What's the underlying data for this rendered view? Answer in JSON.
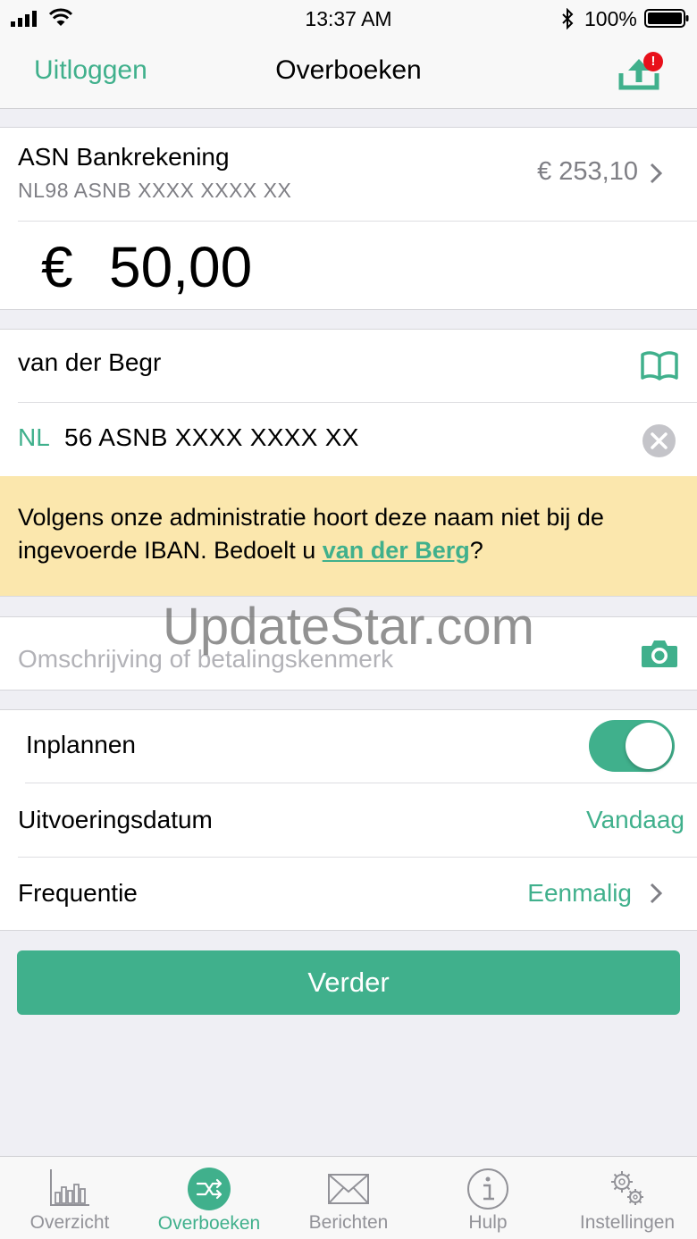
{
  "status_bar": {
    "time": "13:37 AM",
    "battery": "100%"
  },
  "nav": {
    "left": "Uitloggen",
    "title": "Overboeken",
    "badge": "!"
  },
  "account": {
    "name": "ASN Bankrekening",
    "iban": "NL98 ASNB XXXX XXXX XX",
    "balance": "€ 253,10"
  },
  "amount": {
    "currency": "€",
    "value": "50,00"
  },
  "payee": {
    "name": "van der Begr",
    "iban_country": "NL",
    "iban_number": "56  ASNB XXXX XXXX XX"
  },
  "warning": {
    "text_before": "Volgens onze administratie hoort deze naam niet bij de ingevoerde IBAN. Bedoelt u ",
    "link": "van der Berg",
    "text_after": "?"
  },
  "description": {
    "placeholder": "Omschrijving of betalingskenmerk"
  },
  "watermark": "UpdateStar.com",
  "schedule": {
    "inplannen_label": "Inplannen",
    "inplannen_on": true,
    "datum_label": "Uitvoeringsdatum",
    "datum_value": "Vandaag",
    "frequentie_label": "Frequentie",
    "frequentie_value": "Eenmalig"
  },
  "button": {
    "label": "Verder"
  },
  "tabs": [
    {
      "label": "Overzicht",
      "icon": "chart-icon",
      "active": false
    },
    {
      "label": "Overboeken",
      "icon": "transfer-icon",
      "active": true
    },
    {
      "label": "Berichten",
      "icon": "envelope-icon",
      "active": false
    },
    {
      "label": "Hulp",
      "icon": "info-icon",
      "active": false
    },
    {
      "label": "Instellingen",
      "icon": "gears-icon",
      "active": false
    }
  ],
  "colors": {
    "accent": "#40b08c",
    "warning_bg": "#fbe7ad",
    "badge": "#e8101a"
  }
}
